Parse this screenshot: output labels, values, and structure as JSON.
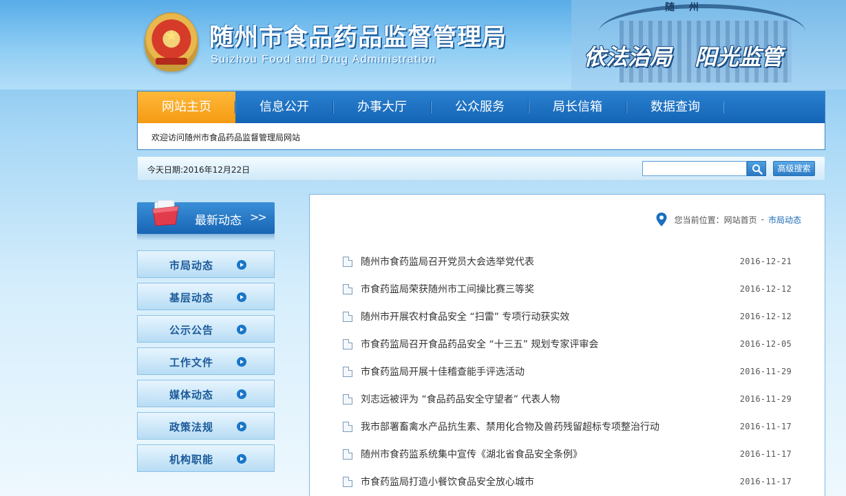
{
  "header": {
    "title_cn": "随州市食品药品监督管理局",
    "title_en": "Suizhou Food and Drug Administration",
    "building_sign": "随 州",
    "slogan": "依法治局 阳光监管"
  },
  "nav": {
    "items": [
      {
        "label": "网站主页"
      },
      {
        "label": "信息公开"
      },
      {
        "label": "办事大厅"
      },
      {
        "label": "公众服务"
      },
      {
        "label": "局长信箱"
      },
      {
        "label": "数据查询"
      }
    ],
    "welcome": "欢迎访问随州市食品药品监督管理局网站"
  },
  "toolbar": {
    "date": "今天日期:2016年12月22日",
    "search_value": "",
    "advanced_search": "高级搜索"
  },
  "sidebar": {
    "title": "最新动态",
    "arrows": ">>",
    "items": [
      {
        "label": "市局动态"
      },
      {
        "label": "基层动态"
      },
      {
        "label": "公示公告"
      },
      {
        "label": "工作文件"
      },
      {
        "label": "媒体动态"
      },
      {
        "label": "政策法规"
      },
      {
        "label": "机构职能"
      }
    ]
  },
  "breadcrumb": {
    "prefix": "您当前位置：",
    "home": "网站首页",
    "separator": "-",
    "current": "市局动态"
  },
  "news": [
    {
      "title": "随州市食药监局召开党员大会选举党代表",
      "date": "2016-12-21"
    },
    {
      "title": "市食药监局荣获随州市工间操比赛三等奖",
      "date": "2016-12-12"
    },
    {
      "title": "随州市开展农村食品安全 “扫雷” 专项行动获实效",
      "date": "2016-12-12"
    },
    {
      "title": "市食药监局召开食品药品安全 “十三五” 规划专家评审会",
      "date": "2016-12-05"
    },
    {
      "title": "市食药监局开展十佳稽查能手评选活动",
      "date": "2016-11-29"
    },
    {
      "title": "刘志远被评为 “食品药品安全守望者” 代表人物",
      "date": "2016-11-29"
    },
    {
      "title": "我市部署畜禽水产品抗生素、禁用化合物及兽药残留超标专项整治行动",
      "date": "2016-11-17"
    },
    {
      "title": "随州市食药监系统集中宣传《湖北省食品安全条例》",
      "date": "2016-11-17"
    },
    {
      "title": "市食药监局打造小餐饮食品安全放心城市",
      "date": "2016-11-17"
    }
  ],
  "colors": {
    "nav_blue": "#1464b6",
    "nav_active": "#f59a12",
    "link_blue": "#1767b8"
  }
}
